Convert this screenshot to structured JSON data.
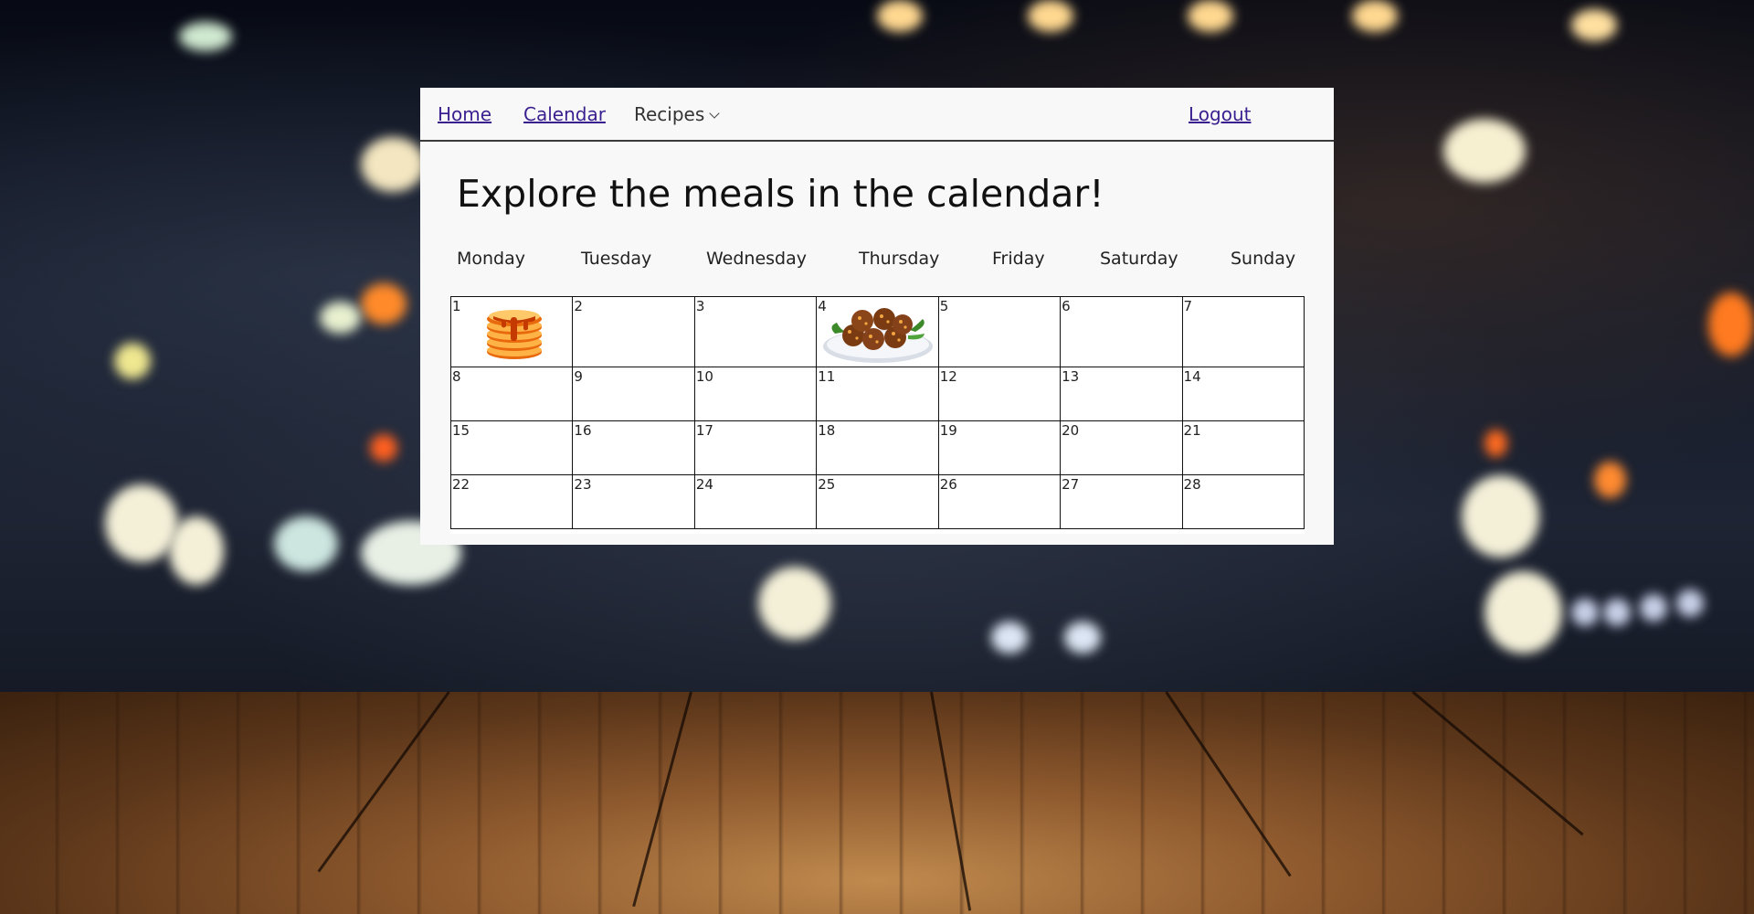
{
  "nav": {
    "home": "Home",
    "calendar": "Calendar",
    "recipes": "Recipes",
    "logout": "Logout"
  },
  "page": {
    "title": "Explore the meals in the calendar!"
  },
  "weekdays": [
    "Monday",
    "Tuesday",
    "Wednesday",
    "Thursday",
    "Friday",
    "Saturday",
    "Sunday"
  ],
  "calendar": {
    "weeks": [
      [
        "1",
        "2",
        "3",
        "4",
        "5",
        "6",
        "7"
      ],
      [
        "8",
        "9",
        "10",
        "11",
        "12",
        "13",
        "14"
      ],
      [
        "15",
        "16",
        "17",
        "18",
        "19",
        "20",
        "21"
      ],
      [
        "22",
        "23",
        "24",
        "25",
        "26",
        "27",
        "28"
      ]
    ],
    "meals": [
      {
        "day": "1",
        "icon": "pancake-stack-icon"
      },
      {
        "day": "4",
        "icon": "meatball-plate-icon"
      }
    ]
  },
  "colors": {
    "link": "#3a1f8f",
    "panel_bg": "#f8f8f8",
    "cell_border": "#111111"
  }
}
